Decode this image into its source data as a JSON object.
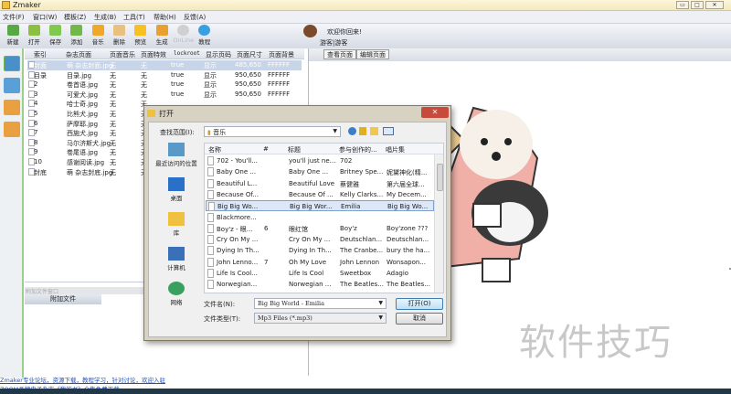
{
  "app": {
    "title": "Zmaker"
  },
  "window_controls": {
    "minimize": "▭",
    "maximize": "□",
    "close": "✕"
  },
  "menu": [
    "文件(F)",
    "窗口(W)",
    "模板(Z)",
    "生成(B)",
    "工具(T)",
    "帮助(H)",
    "反馈(A)"
  ],
  "toolbar": [
    {
      "label": "新建",
      "icon": "new-icon",
      "color": "#58a848"
    },
    {
      "label": "打开",
      "icon": "open-folder-icon",
      "color": "#8cc040"
    },
    {
      "label": "保存",
      "icon": "save-icon",
      "color": "#80c850"
    },
    {
      "label": "添加",
      "icon": "add-icon",
      "color": "#70b848"
    },
    {
      "label": "音乐",
      "icon": "music-icon",
      "color": "#f0a828"
    },
    {
      "label": "删除",
      "icon": "delete-icon",
      "color": "#e8c080"
    },
    {
      "label": "预览",
      "icon": "star-icon",
      "color": "#f8c020"
    },
    {
      "label": "生成",
      "icon": "build-icon",
      "color": "#e8a030"
    },
    {
      "label": "OnLine",
      "icon": "online-icon",
      "color": "#d0d0d0"
    },
    {
      "label": "教程",
      "icon": "help-icon",
      "color": "#38a0e0"
    }
  ],
  "user": {
    "welcome": "欢迎你回来!",
    "name": "游客|游客"
  },
  "side_tabs": [
    {
      "label": "编辑",
      "icon": "edit-icon"
    },
    {
      "label": "设置",
      "icon": "settings-icon"
    },
    {
      "label": "模板",
      "icon": "template-icon"
    },
    {
      "label": "生成",
      "icon": "build-icon"
    }
  ],
  "grid": {
    "columns": [
      "索引",
      "杂志页面",
      "页面音乐",
      "页面特效",
      "lockroot",
      "显示页码",
      "页面尺寸",
      "页面背景"
    ],
    "rows": [
      [
        "封面",
        "萌 杂志封面.jpg",
        "无",
        "无",
        "true",
        "显示",
        "485,650",
        "FFFFFF"
      ],
      [
        "目录",
        "目录.jpg",
        "无",
        "无",
        "true",
        "显示",
        "950,650",
        "FFFFFF"
      ],
      [
        "2",
        "卷首语.jpg",
        "无",
        "无",
        "true",
        "显示",
        "950,650",
        "FFFFFF"
      ],
      [
        "3",
        "可爱犬.jpg",
        "无",
        "无",
        "true",
        "显示",
        "950,650",
        "FFFFFF"
      ],
      [
        "4",
        "哈士奇.jpg",
        "无",
        "无",
        "",
        "",
        "",
        ""
      ],
      [
        "5",
        "比熊犬.jpg",
        "无",
        "无",
        "",
        "",
        "",
        ""
      ],
      [
        "6",
        "萨摩耶.jpg",
        "无",
        "无",
        "",
        "",
        "",
        ""
      ],
      [
        "7",
        "西施犬.jpg",
        "无",
        "无",
        "",
        "",
        "",
        ""
      ],
      [
        "8",
        "马尔济斯犬.jpg",
        "无",
        "无",
        "",
        "",
        "",
        ""
      ],
      [
        "9",
        "卷尾语.jpg",
        "无",
        "无",
        "",
        "",
        "",
        ""
      ],
      [
        "10",
        "感谢阅读.jpg",
        "无",
        "无",
        "",
        "",
        "",
        ""
      ],
      [
        "封底",
        "萌 杂志封底.jpg",
        "无",
        "无",
        "",
        "",
        "",
        ""
      ]
    ],
    "selected_row": 0
  },
  "attach": {
    "header": "附加文件窗口",
    "button": "附加文件"
  },
  "right_tabs": [
    "查看页面",
    "编辑页面"
  ],
  "status": {
    "line1": "Zmaker专业论坛，资源下载，教程学习，针对讨论，欢迎入驻",
    "line2": "ZOOM品牌电子杂志《我的书》全集免费下载"
  },
  "watermark": "软件技巧",
  "dialog": {
    "title": "打开",
    "look_in_label": "查找范围(I):",
    "look_in_value": "音乐",
    "places": [
      {
        "label": "最近访问的位置",
        "icon": "recent-icon"
      },
      {
        "label": "桌面",
        "icon": "desktop-icon"
      },
      {
        "label": "库",
        "icon": "library-icon"
      },
      {
        "label": "计算机",
        "icon": "computer-icon"
      },
      {
        "label": "网络",
        "icon": "network-icon"
      }
    ],
    "columns": [
      "名称",
      "#",
      "标题",
      "参与创作的...",
      "唱片集"
    ],
    "files": [
      [
        "702 - You'll...",
        "",
        "you'll just ne...",
        "702",
        ""
      ],
      [
        "Baby One ...",
        "",
        "Baby One ...",
        "Britney Spe...",
        "妮黛神化(精..."
      ],
      [
        "Beautiful L...",
        "",
        "Beautiful Love",
        "蔡健雅",
        "第六届全球..."
      ],
      [
        "Because Of...",
        "",
        "Because Of ...",
        "Kelly Clarks...",
        "My Decem..."
      ],
      [
        "Big Big Wo...",
        "",
        "Big Big Wor...",
        "Emilia",
        "Big Big Wo..."
      ],
      [
        "Blackmore...",
        "",
        "",
        "",
        ""
      ],
      [
        "Boy'z - 眼...",
        "6",
        "眼红馆",
        "Boy'z",
        "Boy'zone ???"
      ],
      [
        "Cry On My ...",
        "",
        "Cry On My ...",
        "Deutschlan...",
        "Deutschlan..."
      ],
      [
        "Dying In Th...",
        "",
        "Dying In Th...",
        "The Cranbe...",
        "bury the ha..."
      ],
      [
        "John Lenno...",
        "7",
        "Oh My Love",
        "John Lennon",
        "Wonsapon..."
      ],
      [
        "Life Is Cool...",
        "",
        "Life Is Cool",
        "Sweetbox",
        "Adagio"
      ],
      [
        "Norwegian...",
        "",
        "Norwegian ...",
        "The Beatles...",
        "The Beatles..."
      ]
    ],
    "selected_file": 4,
    "filename_label": "文件名(N):",
    "filename_value": "Big Big World - Emilia",
    "filetype_label": "文件类型(T):",
    "filetype_value": "Mp3 Files (*.mp3)",
    "open_button": "打开(O)",
    "cancel_button": "取消",
    "close": "✕"
  }
}
